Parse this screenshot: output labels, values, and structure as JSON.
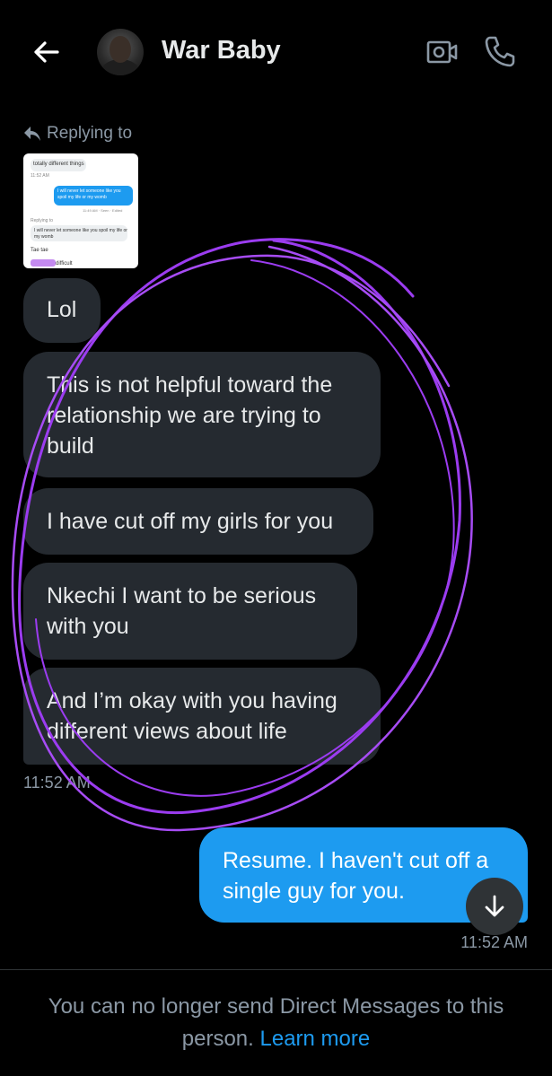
{
  "header": {
    "title": "War Baby",
    "back_icon": "arrow-left-icon",
    "video_icon": "video-camera-icon",
    "call_icon": "phone-icon"
  },
  "reply": {
    "label": "Replying to",
    "thumb": {
      "line1": "totally different things",
      "time1": "11:52 AM",
      "blue1": "I will never let someone like you spoil my life or my womb",
      "meta": "11:49 AM · Seen · Edited",
      "replying": "Replying to",
      "quote": "I will never let someone like you spoil my life or my womb",
      "tae": "Tae tae",
      "difficult": "difficult"
    }
  },
  "messages": [
    {
      "text": "Lol"
    },
    {
      "text": "This is not helpful toward the relationship we are trying to build"
    },
    {
      "text": "I have cut off my girls for you"
    },
    {
      "text": "Nkechi I want to be serious with you"
    },
    {
      "text": "And I’m okay with you having different views about life"
    }
  ],
  "received_time": "11:52 AM",
  "sent": {
    "text": "Resume. I haven't cut off a single guy for you.",
    "time": "11:52 AM"
  },
  "footer": {
    "text": "You can no longer send Direct Messages to this person.",
    "link": "Learn more"
  },
  "colors": {
    "background": "#000000",
    "bubble_received": "#252a30",
    "bubble_sent": "#1d9bf0",
    "accent": "#1d9bf0",
    "scribble": "#9b3cf0"
  }
}
